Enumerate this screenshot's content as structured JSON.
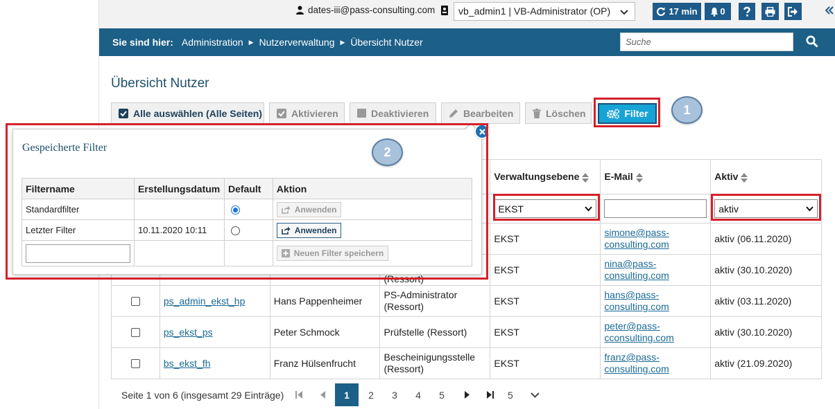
{
  "topbar": {
    "user_email": "dates-iii@pass-consulting.com",
    "role_select": "vb_admin1 | VB-Administrator (OP)",
    "session_time": "17 min",
    "notification_count": "0"
  },
  "breadcrumb": {
    "lead": "Sie sind hier:",
    "items": [
      "Administration",
      "Nutzerverwaltung",
      "Übersicht Nutzer"
    ]
  },
  "search": {
    "placeholder": "Suche"
  },
  "page": {
    "title": "Übersicht Nutzer"
  },
  "toolbar": {
    "select_all": "Alle auswählen (Alle Seiten)",
    "activate": "Aktivieren",
    "deactivate": "Deaktivieren",
    "edit": "Bearbeiten",
    "delete": "Löschen",
    "filter": "Filter"
  },
  "markers": [
    "1",
    "2"
  ],
  "table": {
    "headers": {
      "verwaltungsebene": "Verwaltungsebene",
      "email": "E-Mail",
      "aktiv": "Aktiv"
    },
    "filters": {
      "verwaltungsebene": "EKST",
      "email": "",
      "aktiv": "aktiv"
    },
    "rows": [
      {
        "username": "",
        "name": "",
        "role": "",
        "level": "EKST",
        "email_1": "simone@pass-",
        "email_2": "consulting.com",
        "active": "aktiv (06.11.2020)"
      },
      {
        "username": "",
        "name": "",
        "role": "(Ressort)",
        "level": "EKST",
        "email_1": "nina@pass-",
        "email_2": "consulting.com",
        "active": "aktiv (30.10.2020)"
      },
      {
        "username": "ps_admin_ekst_hp",
        "name": "Hans Pappenheimer",
        "role": "PS-Administrator (Ressort)",
        "level": "EKST",
        "email_1": "hans@pass-",
        "email_2": "consulting.com",
        "active": "aktiv (03.11.2020)"
      },
      {
        "username": "ps_ekst_ps",
        "name": "Peter Schmock",
        "role": "Prüfstelle (Ressort)",
        "level": "EKST",
        "email_1": "peter@pass-",
        "email_2": "cconsulting.com",
        "active": "aktiv (30.10.2020)"
      },
      {
        "username": "bs_ekst_fh",
        "name": "Franz Hülsenfrucht",
        "role": "Bescheinigungsstelle (Ressort)",
        "level": "EKST",
        "email_1": "franz@pass-",
        "email_2": "consulting.com",
        "active": "aktiv (21.09.2020)"
      }
    ]
  },
  "pagination": {
    "summary": "Seite 1 von 6 (insgesamt 29 Einträge)",
    "pages": [
      "1",
      "2",
      "3",
      "4",
      "5"
    ],
    "page_size": "5"
  },
  "saved_filters": {
    "title": "Gespeicherte Filter",
    "headers": [
      "Filtername",
      "Erstellungsdatum",
      "Default",
      "Aktion"
    ],
    "rows": [
      {
        "name": "Standardfilter",
        "date": "",
        "default": true,
        "action": "Anwenden",
        "enabled": false
      },
      {
        "name": "Letzter Filter",
        "date": "10.11.2020 10:11",
        "default": false,
        "action": "Anwenden",
        "enabled": true
      }
    ],
    "new_filter_name": "",
    "save_new": "Neuen Filter speichern"
  }
}
